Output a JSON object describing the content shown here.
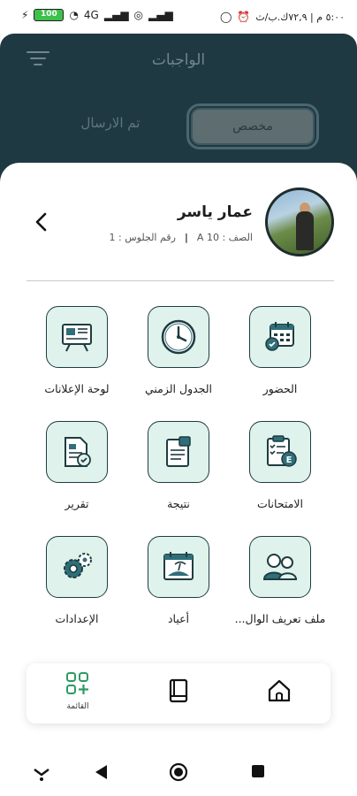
{
  "status_bar": {
    "time_text": "٥:٠٠ م | ٧٢,٩ك.ب/ث",
    "battery": "100",
    "net_label": "4G"
  },
  "header": {
    "title": "الواجبات",
    "tab_custom": "مخصص",
    "tab_sent": "تم الارسال"
  },
  "profile": {
    "name": "عمار ياسر",
    "class_text": "الصف : A 10",
    "seat_text": "رقم الجلوس : 1"
  },
  "grid": {
    "attendance": "الحضور",
    "timetable": "الجدول الزمني",
    "announcements": "لوحة الإعلانات",
    "exams": "الامتحانات",
    "result": "نتيجة",
    "report": "تقرير",
    "parent_profile": "ملف تعريف الوال...",
    "holidays": "أعياد",
    "settings": "الإعدادات"
  },
  "bottom_nav": {
    "menu_label": "القائمة"
  },
  "colors": {
    "dark_header": "#1f3942",
    "tile_bg": "#dff2ec",
    "tile_border": "#1f3c40",
    "accent_green": "#2d9a63"
  }
}
